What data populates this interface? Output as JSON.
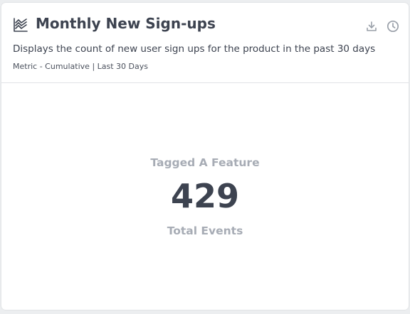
{
  "widget": {
    "icon": "line-chart-icon",
    "title": "Monthly New Sign-ups",
    "description": "Displays the count of new user sign ups for the product in the past 30 days",
    "meta": "Metric - Cumulative | Last 30 Days",
    "actions": {
      "download_icon": "download-icon",
      "history_icon": "clock-icon"
    }
  },
  "metric": {
    "label": "Tagged A Feature",
    "value": "429",
    "unit": "Total Events"
  },
  "colors": {
    "title_text": "#3d4350",
    "muted_text": "#a7acb5",
    "icon_gray": "#9aa0a9",
    "divider": "#e1e3e6"
  }
}
